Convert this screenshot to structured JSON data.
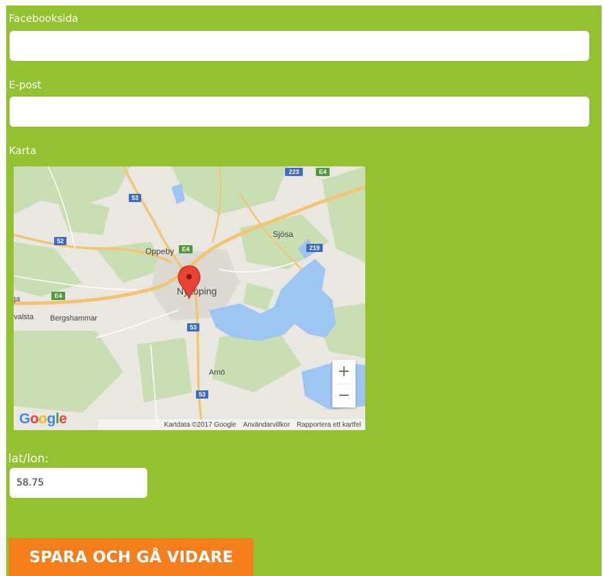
{
  "form": {
    "facebook_label": "Facebooksida",
    "facebook_value": "",
    "email_label": "E-post",
    "email_value": "",
    "map_label": "Karta",
    "latlon_label": "lat/lon:",
    "latlon_value": "58.75",
    "save_label": "SPARA OCH GÅ VIDARE"
  },
  "map": {
    "places": {
      "sjosa": "Sjösa",
      "oppeby": "Oppeby",
      "nykoping": "Nyköping",
      "valsta": "Svalsta",
      "bergshammar": "Bergshammar",
      "arno": "Arnö",
      "ga": "ga"
    },
    "road_shields": {
      "r223": "223",
      "e4_top": "E4",
      "r53_top": "53",
      "r52": "52",
      "e4_oppeby": "E4",
      "r219": "219",
      "e4_west": "E4",
      "r53_mid": "53",
      "r53_low": "53"
    },
    "zoom_in": "+",
    "zoom_out": "−",
    "logo": "Google",
    "footer": {
      "map_data": "Kartdata ©2017 Google",
      "terms": "Användarvillkor",
      "report": "Rapportera ett kartfel"
    },
    "colors": {
      "land": "#e9e7e0",
      "forest": "#c9dfb3",
      "water": "#9ec4f2",
      "road": "#f2c474",
      "marker": "#e84235"
    }
  }
}
